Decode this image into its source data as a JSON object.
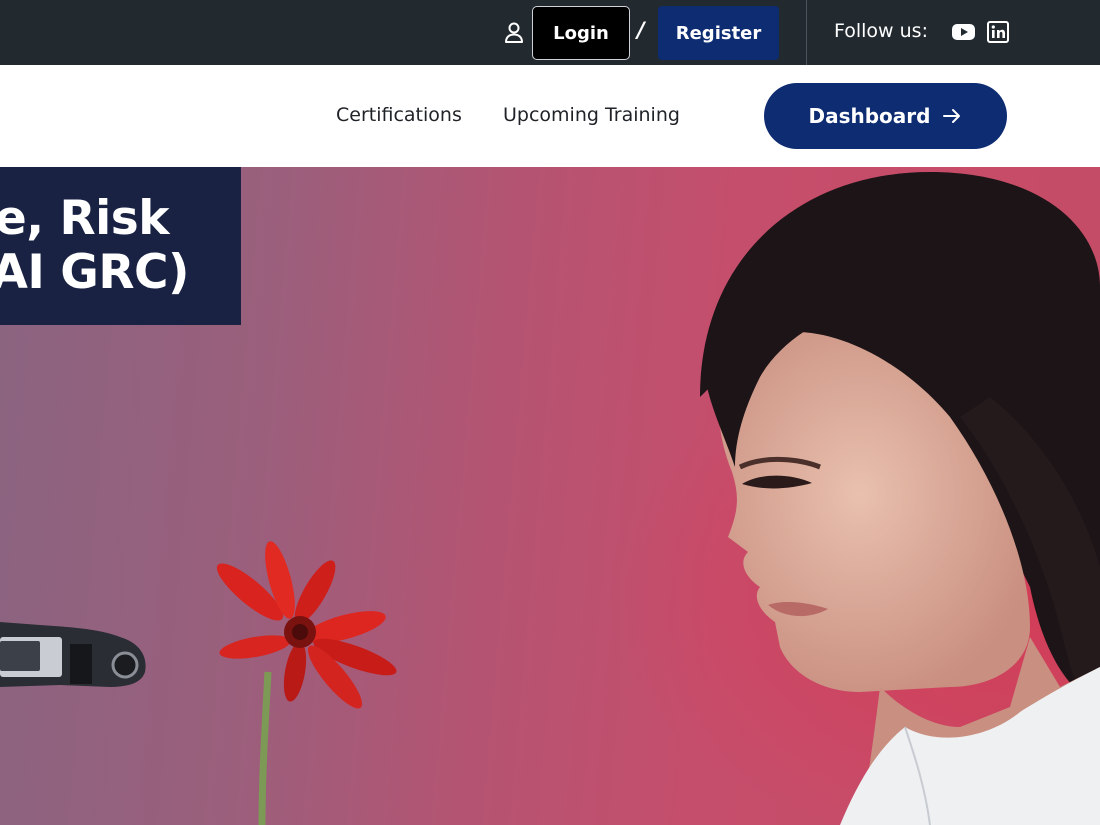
{
  "topbar": {
    "login_label": "Login",
    "separator": "/",
    "register_label": "Register",
    "follow_label": "Follow us:",
    "social": [
      {
        "icon": "youtube-icon"
      },
      {
        "icon": "linkedin-icon"
      }
    ]
  },
  "nav": {
    "items": [
      {
        "label": "Certifications"
      },
      {
        "label": "Upcoming Training"
      }
    ],
    "dashboard_label": "Dashboard"
  },
  "hero": {
    "title_lines": [
      "ce, Risk",
      "AI GRC)"
    ]
  },
  "colors": {
    "topbar_bg": "#222a30",
    "primary": "#0d2c72",
    "hero_title_bg": "#1a2244"
  }
}
